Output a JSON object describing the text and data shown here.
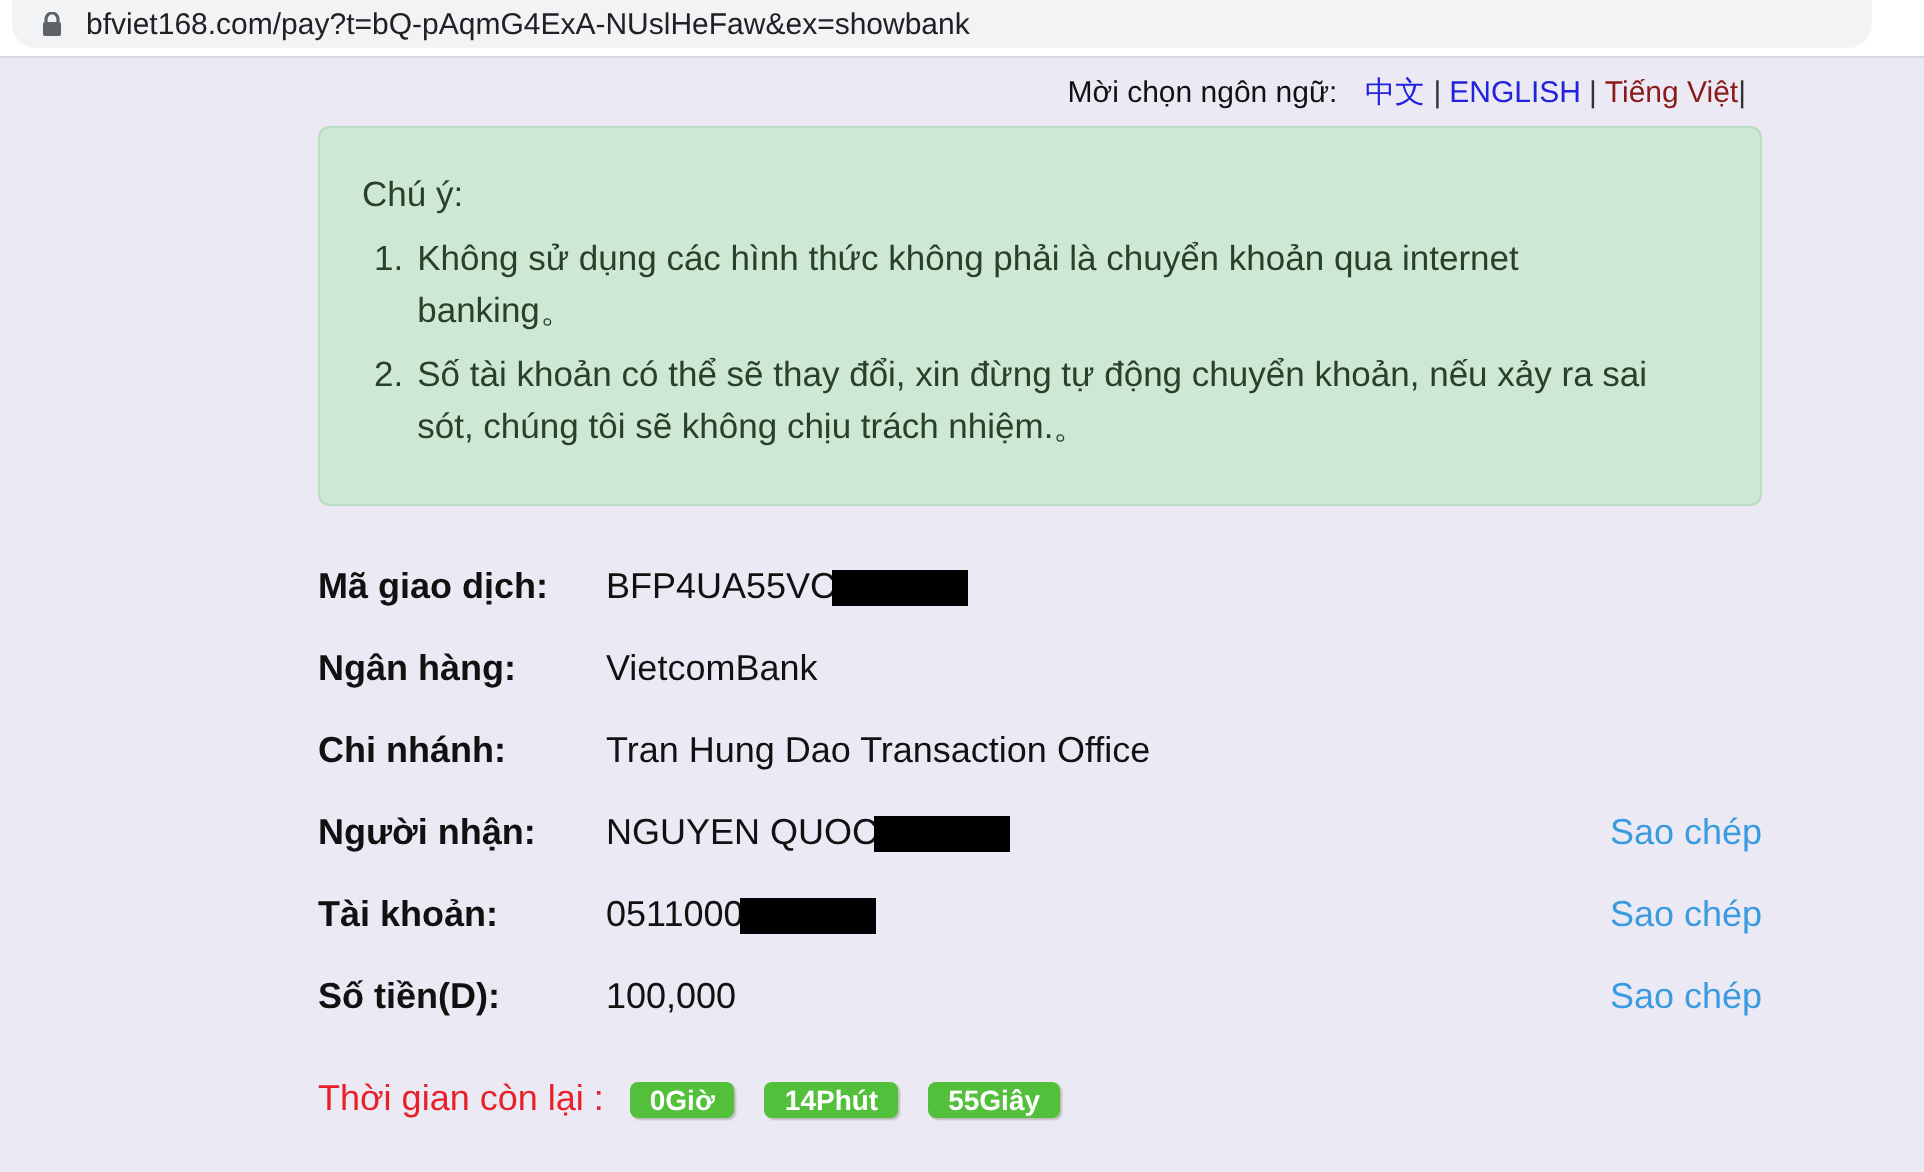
{
  "browser": {
    "url": "bfviet168.com/pay?t=bQ-pAqmG4ExA-NUslHeFaw&ex=showbank"
  },
  "language_bar": {
    "prompt": "Mời chọn ngôn ngữ:",
    "languages": [
      {
        "label": "中文",
        "separator": "|",
        "selected": false
      },
      {
        "label": "ENGLISH",
        "separator": "|",
        "selected": false
      },
      {
        "label": "Tiếng Việt",
        "separator": "|",
        "selected": true
      }
    ]
  },
  "notice": {
    "title": "Chú ý:",
    "items": [
      {
        "number": "1.",
        "text": "Không sử dụng các hình thức không phải là chuyển khoản qua internet banking。"
      },
      {
        "number": "2.",
        "text": "Số tài khoản có thể sẽ thay đổi, xin đừng tự động chuyển khoản, nếu xảy ra sai sót, chúng tôi sẽ không chịu trách nhiệm.。"
      }
    ]
  },
  "details": [
    {
      "label": "Mã giao dịch:",
      "value": "BFP4UA55VC",
      "redacted": true
    },
    {
      "label": "Ngân hàng:",
      "value": "VietcomBank",
      "redacted": false
    },
    {
      "label": "Chi nhánh:",
      "value": "Tran Hung Dao Transaction Office",
      "redacted": false
    },
    {
      "label": "Người nhận:",
      "value": "NGUYEN QUOC",
      "redacted": true,
      "copy": "Sao chép"
    },
    {
      "label": "Tài khoản:",
      "value": "0511000",
      "redacted": true,
      "copy": "Sao chép"
    },
    {
      "label": "Số tiền(D):",
      "value": "100,000",
      "redacted": false,
      "copy": "Sao chép"
    }
  ],
  "countdown": {
    "label": "Thời gian còn lại :",
    "parts": [
      "0Giờ",
      "14Phút",
      "55Giây"
    ]
  }
}
